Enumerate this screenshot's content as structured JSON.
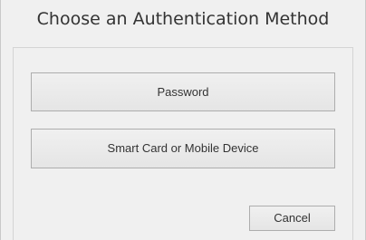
{
  "dialog": {
    "title": "Choose an Authentication Method"
  },
  "options": {
    "password_label": "Password",
    "smart_card_label": "Smart Card or Mobile Device"
  },
  "actions": {
    "cancel_label": "Cancel"
  }
}
